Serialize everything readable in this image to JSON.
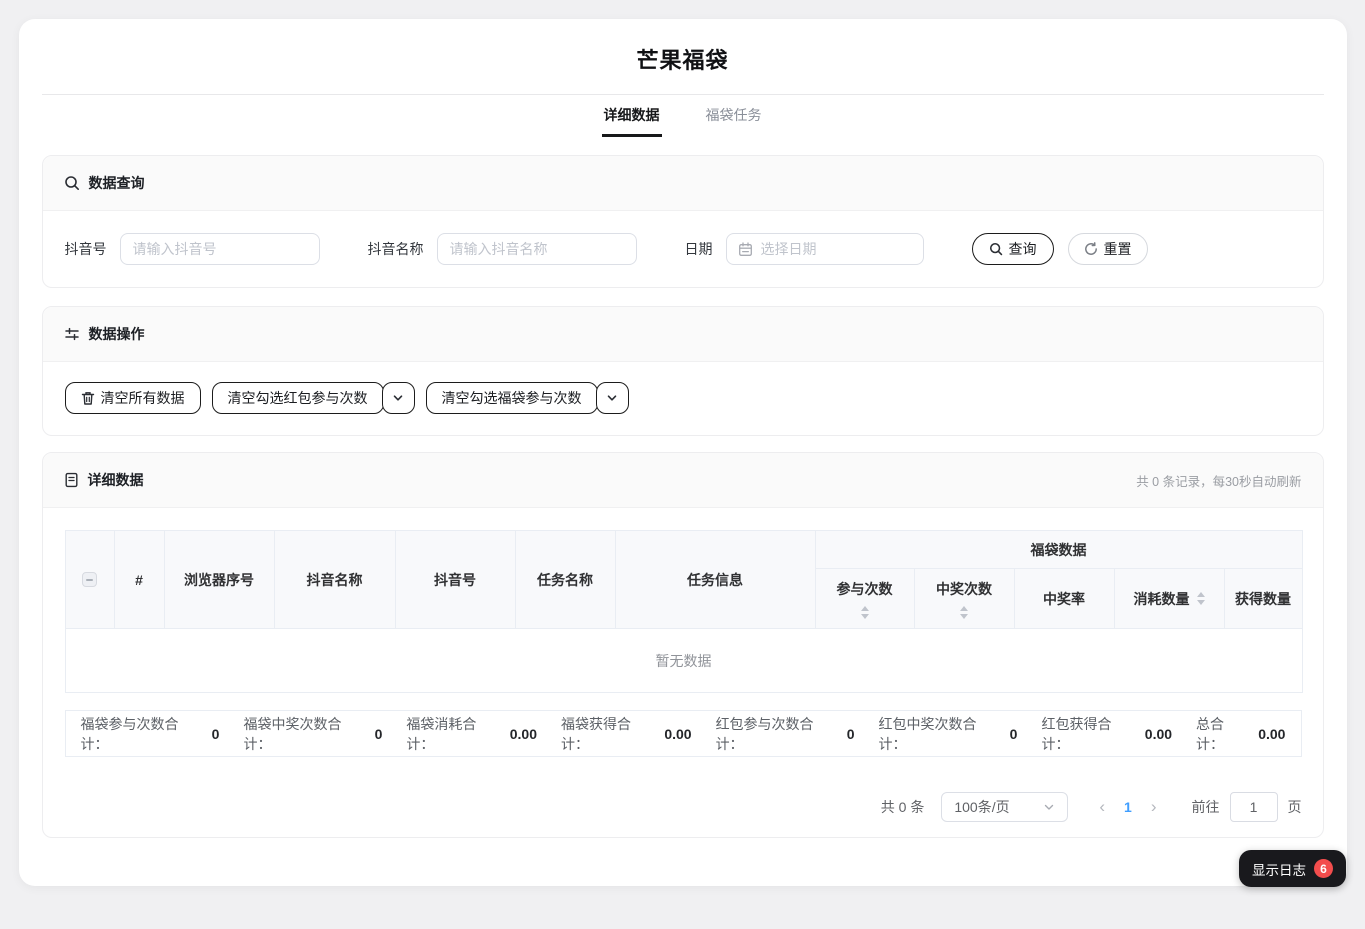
{
  "page": {
    "title": "芒果福袋"
  },
  "tabs": [
    {
      "label": "详细数据",
      "active": true
    },
    {
      "label": "福袋任务",
      "active": false
    }
  ],
  "query": {
    "section_title": "数据查询",
    "fields": [
      {
        "label": "抖音号",
        "placeholder": "请输入抖音号"
      },
      {
        "label": "抖音名称",
        "placeholder": "请输入抖音名称"
      },
      {
        "label": "日期",
        "placeholder": "选择日期"
      }
    ],
    "search_label": "查询",
    "reset_label": "重置"
  },
  "operations": {
    "section_title": "数据操作",
    "clear_all_label": "清空所有数据",
    "clear_redpacket_label": "清空勾选红包参与次数",
    "clear_luckybag_label": "清空勾选福袋参与次数"
  },
  "table_section": {
    "section_title": "详细数据",
    "record_info": "共 0 条记录，每30秒自动刷新",
    "columns": [
      "#",
      "浏览器序号",
      "抖音名称",
      "抖音号",
      "任务名称",
      "任务信息"
    ],
    "group_header": "福袋数据",
    "sub_columns": [
      {
        "label": "参与次数",
        "sortable": true
      },
      {
        "label": "中奖次数",
        "sortable": true
      },
      {
        "label": "中奖率",
        "sortable": false
      },
      {
        "label": "消耗数量",
        "sortable": true
      },
      {
        "label": "获得数量",
        "sortable": false
      }
    ],
    "empty_text": "暂无数据"
  },
  "summary": {
    "items": [
      {
        "label": "福袋参与次数合计：",
        "value": "0"
      },
      {
        "label": "福袋中奖次数合计：",
        "value": "0"
      },
      {
        "label": "福袋消耗合计：",
        "value": "0.00"
      },
      {
        "label": "福袋获得合计：",
        "value": "0.00"
      },
      {
        "label": "红包参与次数合计：",
        "value": "0"
      },
      {
        "label": "红包中奖次数合计：",
        "value": "0"
      },
      {
        "label": "红包获得合计：",
        "value": "0.00"
      },
      {
        "label": "总合计：",
        "value": "0.00"
      }
    ]
  },
  "pagination": {
    "total_text": "共 0 条",
    "page_size": "100条/页",
    "prev_arrow": "‹",
    "next_arrow": "›",
    "current_page": "1",
    "goto_label": "前往",
    "goto_value": "1",
    "page_unit": "页"
  },
  "log_button": {
    "label": "显示日志",
    "badge": "6"
  },
  "colors": {
    "accent_blue": "#409eff",
    "badge_red": "#f34d4d",
    "dark_button": "#19191d",
    "header_bg": "#fafafa",
    "table_header_bg": "#f8f9fb"
  }
}
